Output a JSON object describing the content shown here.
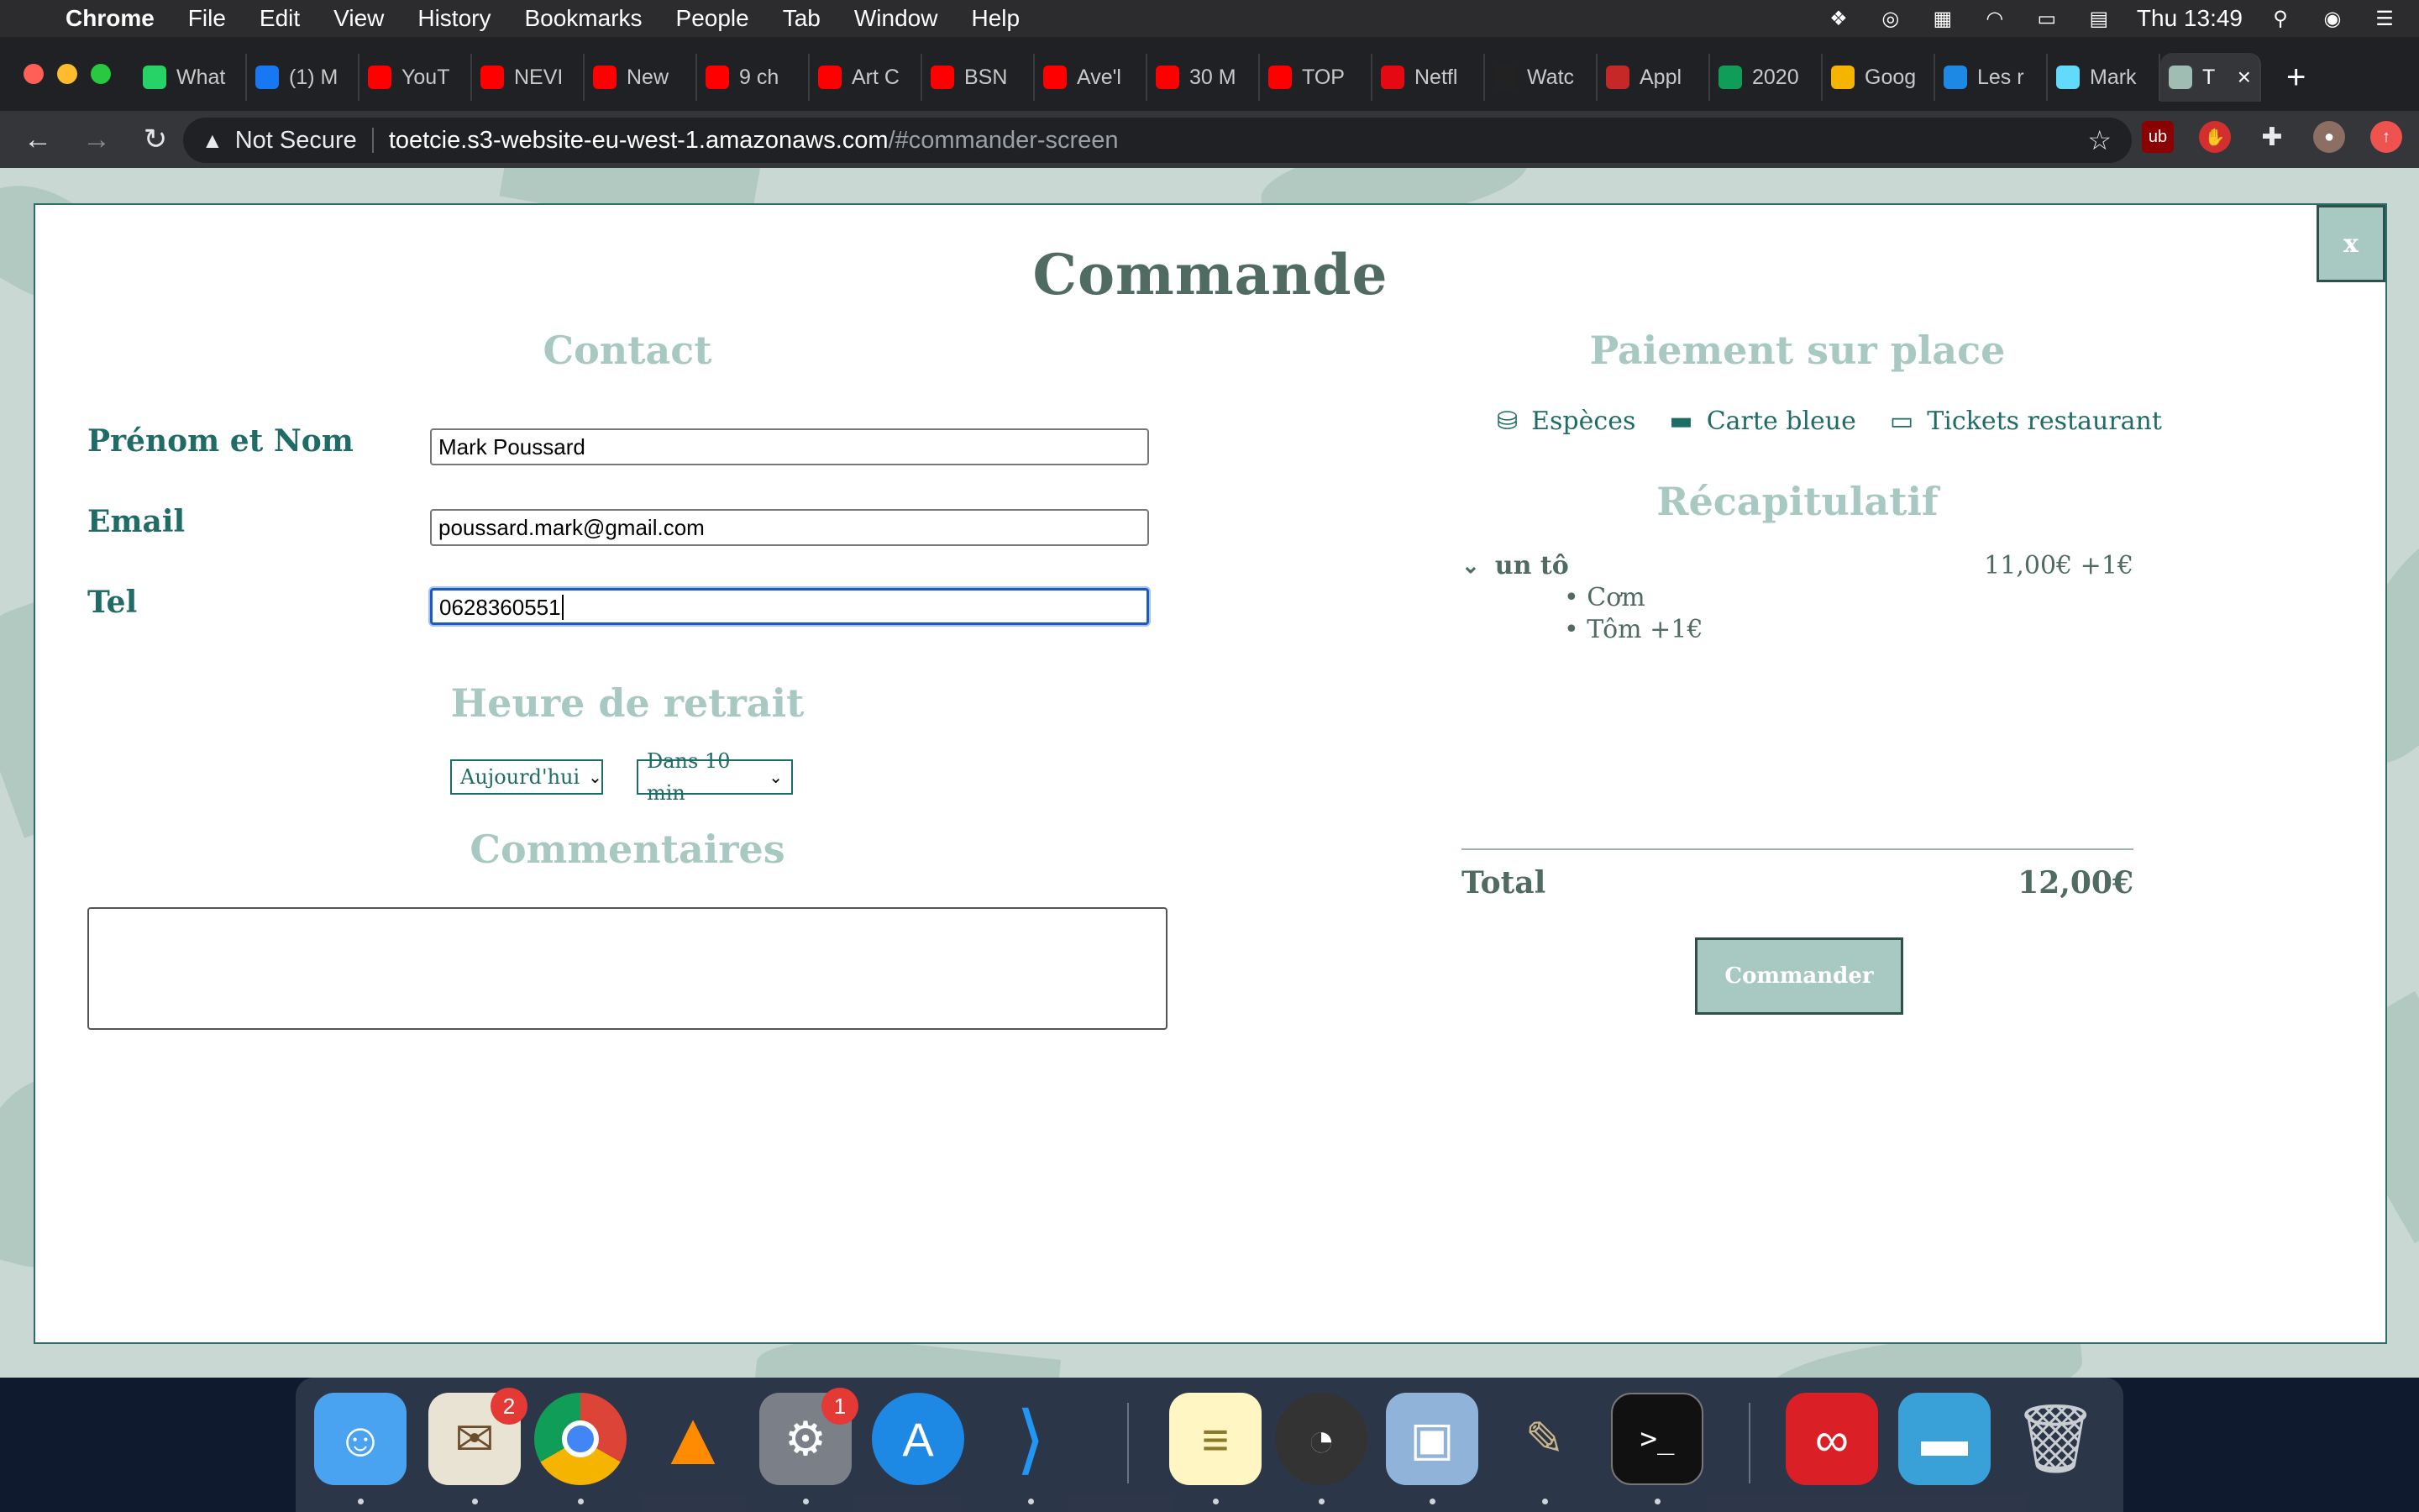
{
  "menubar": {
    "app": "Chrome",
    "items": [
      "File",
      "Edit",
      "View",
      "History",
      "Bookmarks",
      "People",
      "Tab",
      "Window",
      "Help"
    ],
    "clock": "Thu 13:49"
  },
  "tabs": [
    {
      "label": "What",
      "icon": "whatsapp-icon",
      "color": "#25d366"
    },
    {
      "label": "(1) M",
      "icon": "facebook-icon",
      "color": "#1877f2"
    },
    {
      "label": "YouT",
      "icon": "youtube-icon",
      "color": "#ff0000"
    },
    {
      "label": "NEVI",
      "icon": "youtube-icon",
      "color": "#ff0000"
    },
    {
      "label": "New",
      "icon": "youtube-icon",
      "color": "#ff0000"
    },
    {
      "label": "9 ch",
      "icon": "youtube-icon",
      "color": "#ff0000"
    },
    {
      "label": "Art C",
      "icon": "youtube-icon",
      "color": "#ff0000"
    },
    {
      "label": "BSN",
      "icon": "youtube-icon",
      "color": "#ff0000"
    },
    {
      "label": "Ave'l",
      "icon": "youtube-icon",
      "color": "#ff0000"
    },
    {
      "label": "30 M",
      "icon": "youtube-icon",
      "color": "#ff0000"
    },
    {
      "label": "TOP",
      "icon": "youtube-icon",
      "color": "#ff0000"
    },
    {
      "label": "Netfl",
      "icon": "netflix-icon",
      "color": "#e50914"
    },
    {
      "label": "Watc",
      "icon": "w-icon",
      "color": "#222222"
    },
    {
      "label": "Appl",
      "icon": "c-icon",
      "color": "#c62828"
    },
    {
      "label": "2020",
      "icon": "sheets-icon",
      "color": "#0f9d58"
    },
    {
      "label": "Goog",
      "icon": "keep-icon",
      "color": "#f4b400"
    },
    {
      "label": "Les r",
      "icon": "bookmark-icon",
      "color": "#1e88e5"
    },
    {
      "label": "Mark",
      "icon": "react-icon",
      "color": "#61dafb"
    },
    {
      "label": "T",
      "icon": "page-icon",
      "color": "#9fbdb3"
    }
  ],
  "omnibox": {
    "security": "Not Secure",
    "host": "toetcie.s3-website-eu-west-1.amazonaws.com",
    "path": "/#commander-screen"
  },
  "modal": {
    "close_label": "x",
    "title": "Commande",
    "contact": {
      "heading": "Contact",
      "name_label": "Prénom et Nom",
      "name_value": "Mark Poussard",
      "email_label": "Email",
      "email_value": "poussard.mark@gmail.com",
      "tel_label": "Tel",
      "tel_value": "0628360551"
    },
    "pickup": {
      "heading": "Heure de retrait",
      "day": "Aujourd'hui",
      "time": "Dans 10 min"
    },
    "comments_heading": "Commentaires",
    "payment": {
      "heading": "Paiement sur place",
      "options": [
        "Espèces",
        "Carte bleue",
        "Tickets restaurant"
      ]
    },
    "summary": {
      "heading": "Récapitulatif",
      "item_name": "un tô",
      "item_price": "11,00€ +1€",
      "options": [
        "Cơm",
        "Tôm +1€"
      ],
      "total_label": "Total",
      "total_value": "12,00€"
    },
    "order_button": "Commander"
  },
  "dock": {
    "apps": [
      "finder-icon",
      "mail-icon",
      "chrome-icon",
      "vlc-icon",
      "system-preferences-icon",
      "app-store-icon",
      "vscode-icon",
      "notes-icon",
      "instruments-icon",
      "preview-icon",
      "gimp-icon",
      "terminal-icon",
      "creative-cloud-icon",
      "folder-icon",
      "trash-icon"
    ],
    "mail_badge": "2",
    "prefs_badge": "1"
  }
}
